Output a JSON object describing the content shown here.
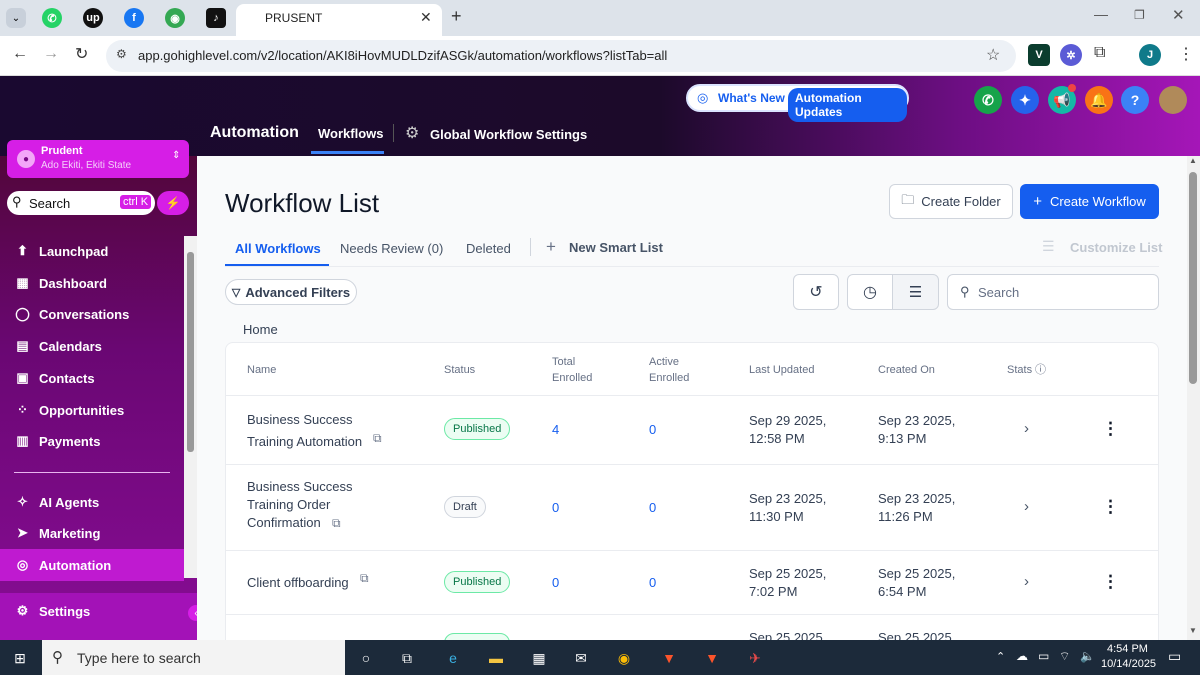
{
  "browser": {
    "tab_title": "PRUSENT",
    "url": "app.gohighlevel.com/v2/location/AKI8iHovMUDLDzifASGk/automation/workflows?listTab=all",
    "profile_initial": "J"
  },
  "header": {
    "section_title": "Automation",
    "tab_workflows": "Workflows",
    "tab_global_settings": "Global Workflow Settings",
    "whats_new": "What's New",
    "automation_updates": "Automation Updates"
  },
  "sidebar": {
    "account_name": "Prudent",
    "account_location": "Ado Ekiti, Ekiti State",
    "search_label": "Search",
    "search_shortcut": "ctrl K",
    "items": [
      {
        "label": "Launchpad",
        "icon": "rocket-icon"
      },
      {
        "label": "Dashboard",
        "icon": "grid-icon"
      },
      {
        "label": "Conversations",
        "icon": "chat-icon"
      },
      {
        "label": "Calendars",
        "icon": "calendar-icon"
      },
      {
        "label": "Contacts",
        "icon": "contacts-icon"
      },
      {
        "label": "Opportunities",
        "icon": "opportunities-icon"
      },
      {
        "label": "Payments",
        "icon": "payments-icon"
      }
    ],
    "items2": [
      {
        "label": "AI Agents",
        "icon": "sparkle-icon"
      },
      {
        "label": "Marketing",
        "icon": "send-icon"
      },
      {
        "label": "Automation",
        "icon": "automation-icon"
      }
    ],
    "settings_label": "Settings"
  },
  "main": {
    "page_title": "Workflow List",
    "create_folder": "Create Folder",
    "create_workflow": "Create Workflow",
    "tabs": [
      "All Workflows",
      "Needs Review (0)",
      "Deleted"
    ],
    "new_smart_list": "New Smart List",
    "customize_list": "Customize List",
    "advanced_filters": "Advanced Filters",
    "search_placeholder": "Search",
    "breadcrumb": "Home",
    "columns": {
      "name": "Name",
      "status": "Status",
      "total_enrolled": "Total Enrolled",
      "active_enrolled": "Active Enrolled",
      "last_updated": "Last Updated",
      "created_on": "Created On",
      "stats": "Stats"
    },
    "rows": [
      {
        "name": "Business Success Training Automation",
        "status": "Published",
        "total": "4",
        "active": "0",
        "updated": "Sep 29 2025, 12:58 PM",
        "created": "Sep 23 2025, 9:13 PM"
      },
      {
        "name": "Business Success Training Order Confirmation",
        "status": "Draft",
        "total": "0",
        "active": "0",
        "updated": "Sep 23 2025, 11:30 PM",
        "created": "Sep 23 2025, 11:26 PM"
      },
      {
        "name": "Client offboarding",
        "status": "Published",
        "total": "0",
        "active": "0",
        "updated": "Sep 25 2025, 7:02 PM",
        "created": "Sep 25 2025, 6:54 PM"
      }
    ],
    "partial_row": {
      "updated": "Sep 25 2025",
      "created": "Sep 25 2025"
    }
  },
  "taskbar": {
    "search_placeholder": "Type here to search",
    "time": "4:54 PM",
    "date": "10/14/2025"
  }
}
